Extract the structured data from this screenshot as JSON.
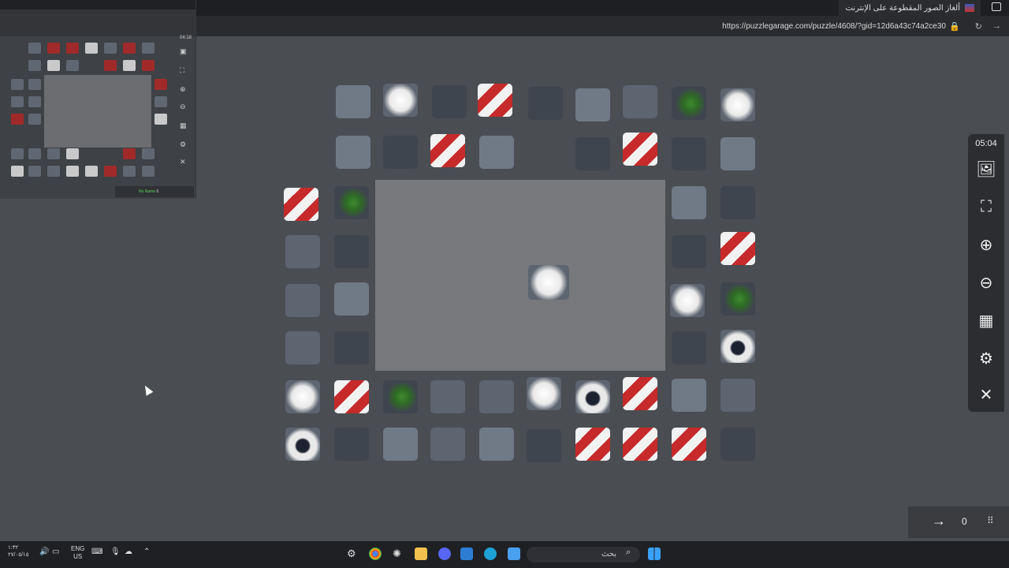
{
  "browser": {
    "tab_title": "ألغاز الصور المقطوعة على الإنترنت",
    "url": "https://puzzlegarage.com/puzzle/4608/?gid=12d6a43c74a2ce30",
    "new_tab": "+",
    "close_tab": "×"
  },
  "thumbnail": {
    "timer": "04:18",
    "player": "No Name",
    "score": "0"
  },
  "game": {
    "timer": "05:04",
    "score": "0",
    "buttons": [
      {
        "name": "image-preview-button",
        "icon": "image-icon",
        "glyph": "🖼"
      },
      {
        "name": "fullscreen-button",
        "icon": "expand-icon",
        "glyph": "⛶"
      },
      {
        "name": "zoom-in-button",
        "icon": "zoom-in-icon",
        "glyph": "⊕"
      },
      {
        "name": "zoom-out-button",
        "icon": "zoom-out-icon",
        "glyph": "⊖"
      },
      {
        "name": "arrange-button",
        "icon": "grid-icon",
        "glyph": "▦"
      },
      {
        "name": "settings-button",
        "icon": "gear-icon",
        "glyph": "⚙"
      },
      {
        "name": "close-button",
        "icon": "close-icon",
        "glyph": "✕"
      }
    ]
  },
  "taskbar": {
    "search_placeholder": "بحث",
    "time": "١:٣٢",
    "date": "٢٧/٠٥/١٥",
    "lang_top": "ENG",
    "lang_bottom": "US"
  }
}
